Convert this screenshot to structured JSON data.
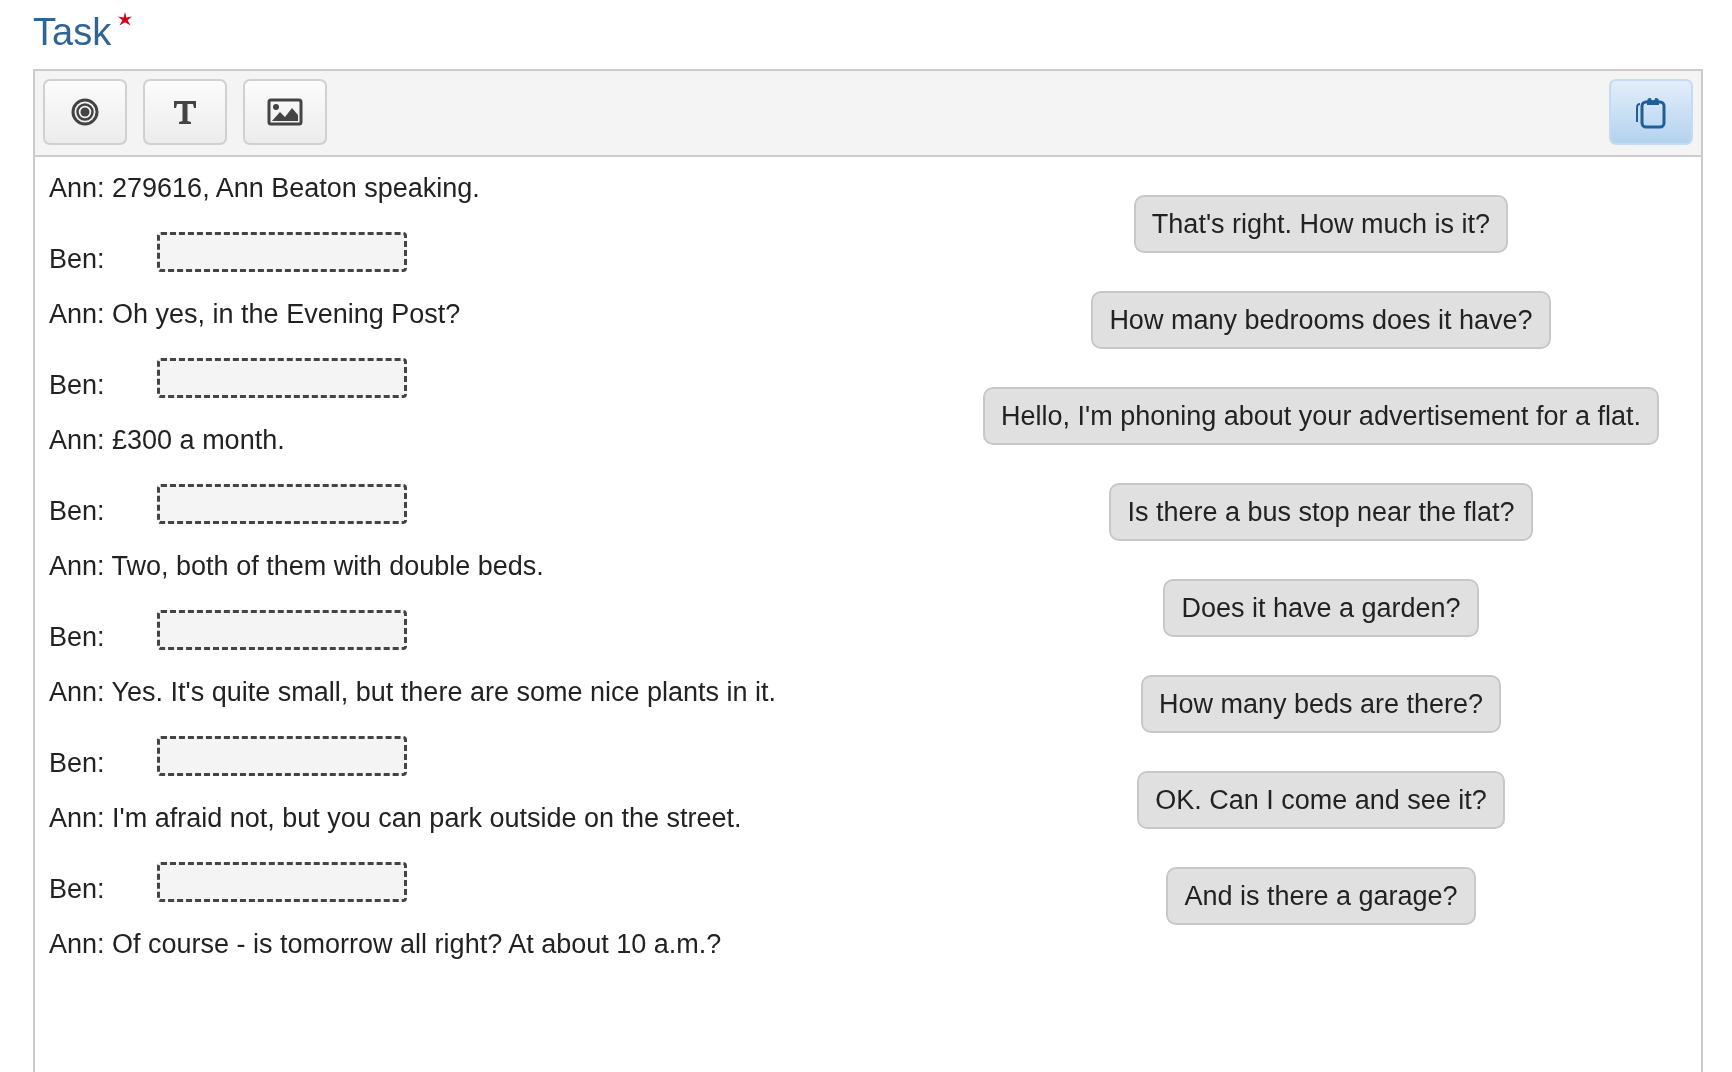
{
  "title": "Task",
  "required": true,
  "toolbar": [
    {
      "kind": "target",
      "selected": false
    },
    {
      "kind": "text",
      "selected": false
    },
    {
      "kind": "image",
      "selected": false
    }
  ],
  "toolbar_right": [
    {
      "kind": "clipboard",
      "selected": true
    }
  ],
  "dialogue": [
    {
      "kind": "line",
      "text": "Ann: 279616, Ann Beaton speaking."
    },
    {
      "kind": "gap",
      "label": "Ben:"
    },
    {
      "kind": "line",
      "text": "Ann: Oh yes, in the Evening Post?"
    },
    {
      "kind": "gap",
      "label": "Ben:"
    },
    {
      "kind": "line",
      "text": "Ann: £300 a month."
    },
    {
      "kind": "gap",
      "label": "Ben:"
    },
    {
      "kind": "line",
      "text": "Ann: Two, both of them with double beds."
    },
    {
      "kind": "gap",
      "label": "Ben:"
    },
    {
      "kind": "line",
      "text": "Ann: Yes. It's quite small, but there are some nice plants in it."
    },
    {
      "kind": "gap",
      "label": "Ben:"
    },
    {
      "kind": "line",
      "text": "Ann: I'm afraid not, but you can park outside on the street."
    },
    {
      "kind": "gap",
      "label": "Ben:"
    },
    {
      "kind": "line",
      "text": "Ann: Of course - is tomorrow all right? At about 10 a.m.?"
    }
  ],
  "answers": [
    "That's right. How much is it?",
    "How many bedrooms does it have?",
    "Hello, I'm phoning about your advertisement for a flat.",
    "Is there a bus stop near the flat?",
    "Does it have a garden?",
    "How many beds are there?",
    "OK. Can I come and see it?",
    "And is there a garage?"
  ]
}
